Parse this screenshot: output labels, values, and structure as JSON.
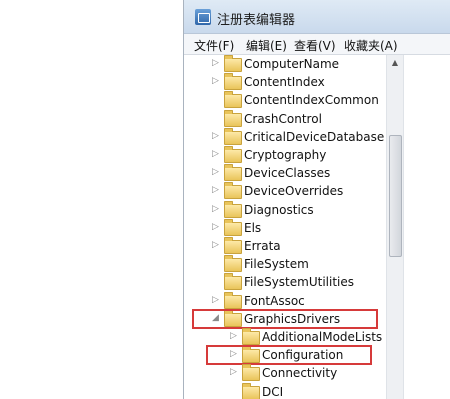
{
  "window": {
    "title": "注册表编辑器",
    "app_icon": "regedit-icon"
  },
  "menu": {
    "items": [
      "文件(F)",
      "编辑(E)",
      "查看(V)",
      "收藏夹(A)"
    ]
  },
  "tree": {
    "items": [
      {
        "label": "ComputerName",
        "expander": "collapsed"
      },
      {
        "label": "ContentIndex",
        "expander": "collapsed"
      },
      {
        "label": "ContentIndexCommon",
        "expander": "none"
      },
      {
        "label": "CrashControl",
        "expander": "none"
      },
      {
        "label": "CriticalDeviceDatabase",
        "expander": "collapsed"
      },
      {
        "label": "Cryptography",
        "expander": "collapsed"
      },
      {
        "label": "DeviceClasses",
        "expander": "collapsed"
      },
      {
        "label": "DeviceOverrides",
        "expander": "collapsed"
      },
      {
        "label": "Diagnostics",
        "expander": "collapsed"
      },
      {
        "label": "Els",
        "expander": "collapsed"
      },
      {
        "label": "Errata",
        "expander": "collapsed"
      },
      {
        "label": "FileSystem",
        "expander": "none"
      },
      {
        "label": "FileSystemUtilities",
        "expander": "none"
      },
      {
        "label": "FontAssoc",
        "expander": "collapsed"
      },
      {
        "label": "GraphicsDrivers",
        "expander": "expanded",
        "highlighted": true
      },
      {
        "label": "AdditionalModeLists",
        "expander": "collapsed"
      },
      {
        "label": "Configuration",
        "expander": "collapsed",
        "highlighted": true
      },
      {
        "label": "Connectivity",
        "expander": "collapsed"
      },
      {
        "label": "DCI",
        "expander": "none"
      }
    ]
  },
  "colors": {
    "highlight_border": "#d63a3a",
    "folder": "#e9c45a"
  }
}
